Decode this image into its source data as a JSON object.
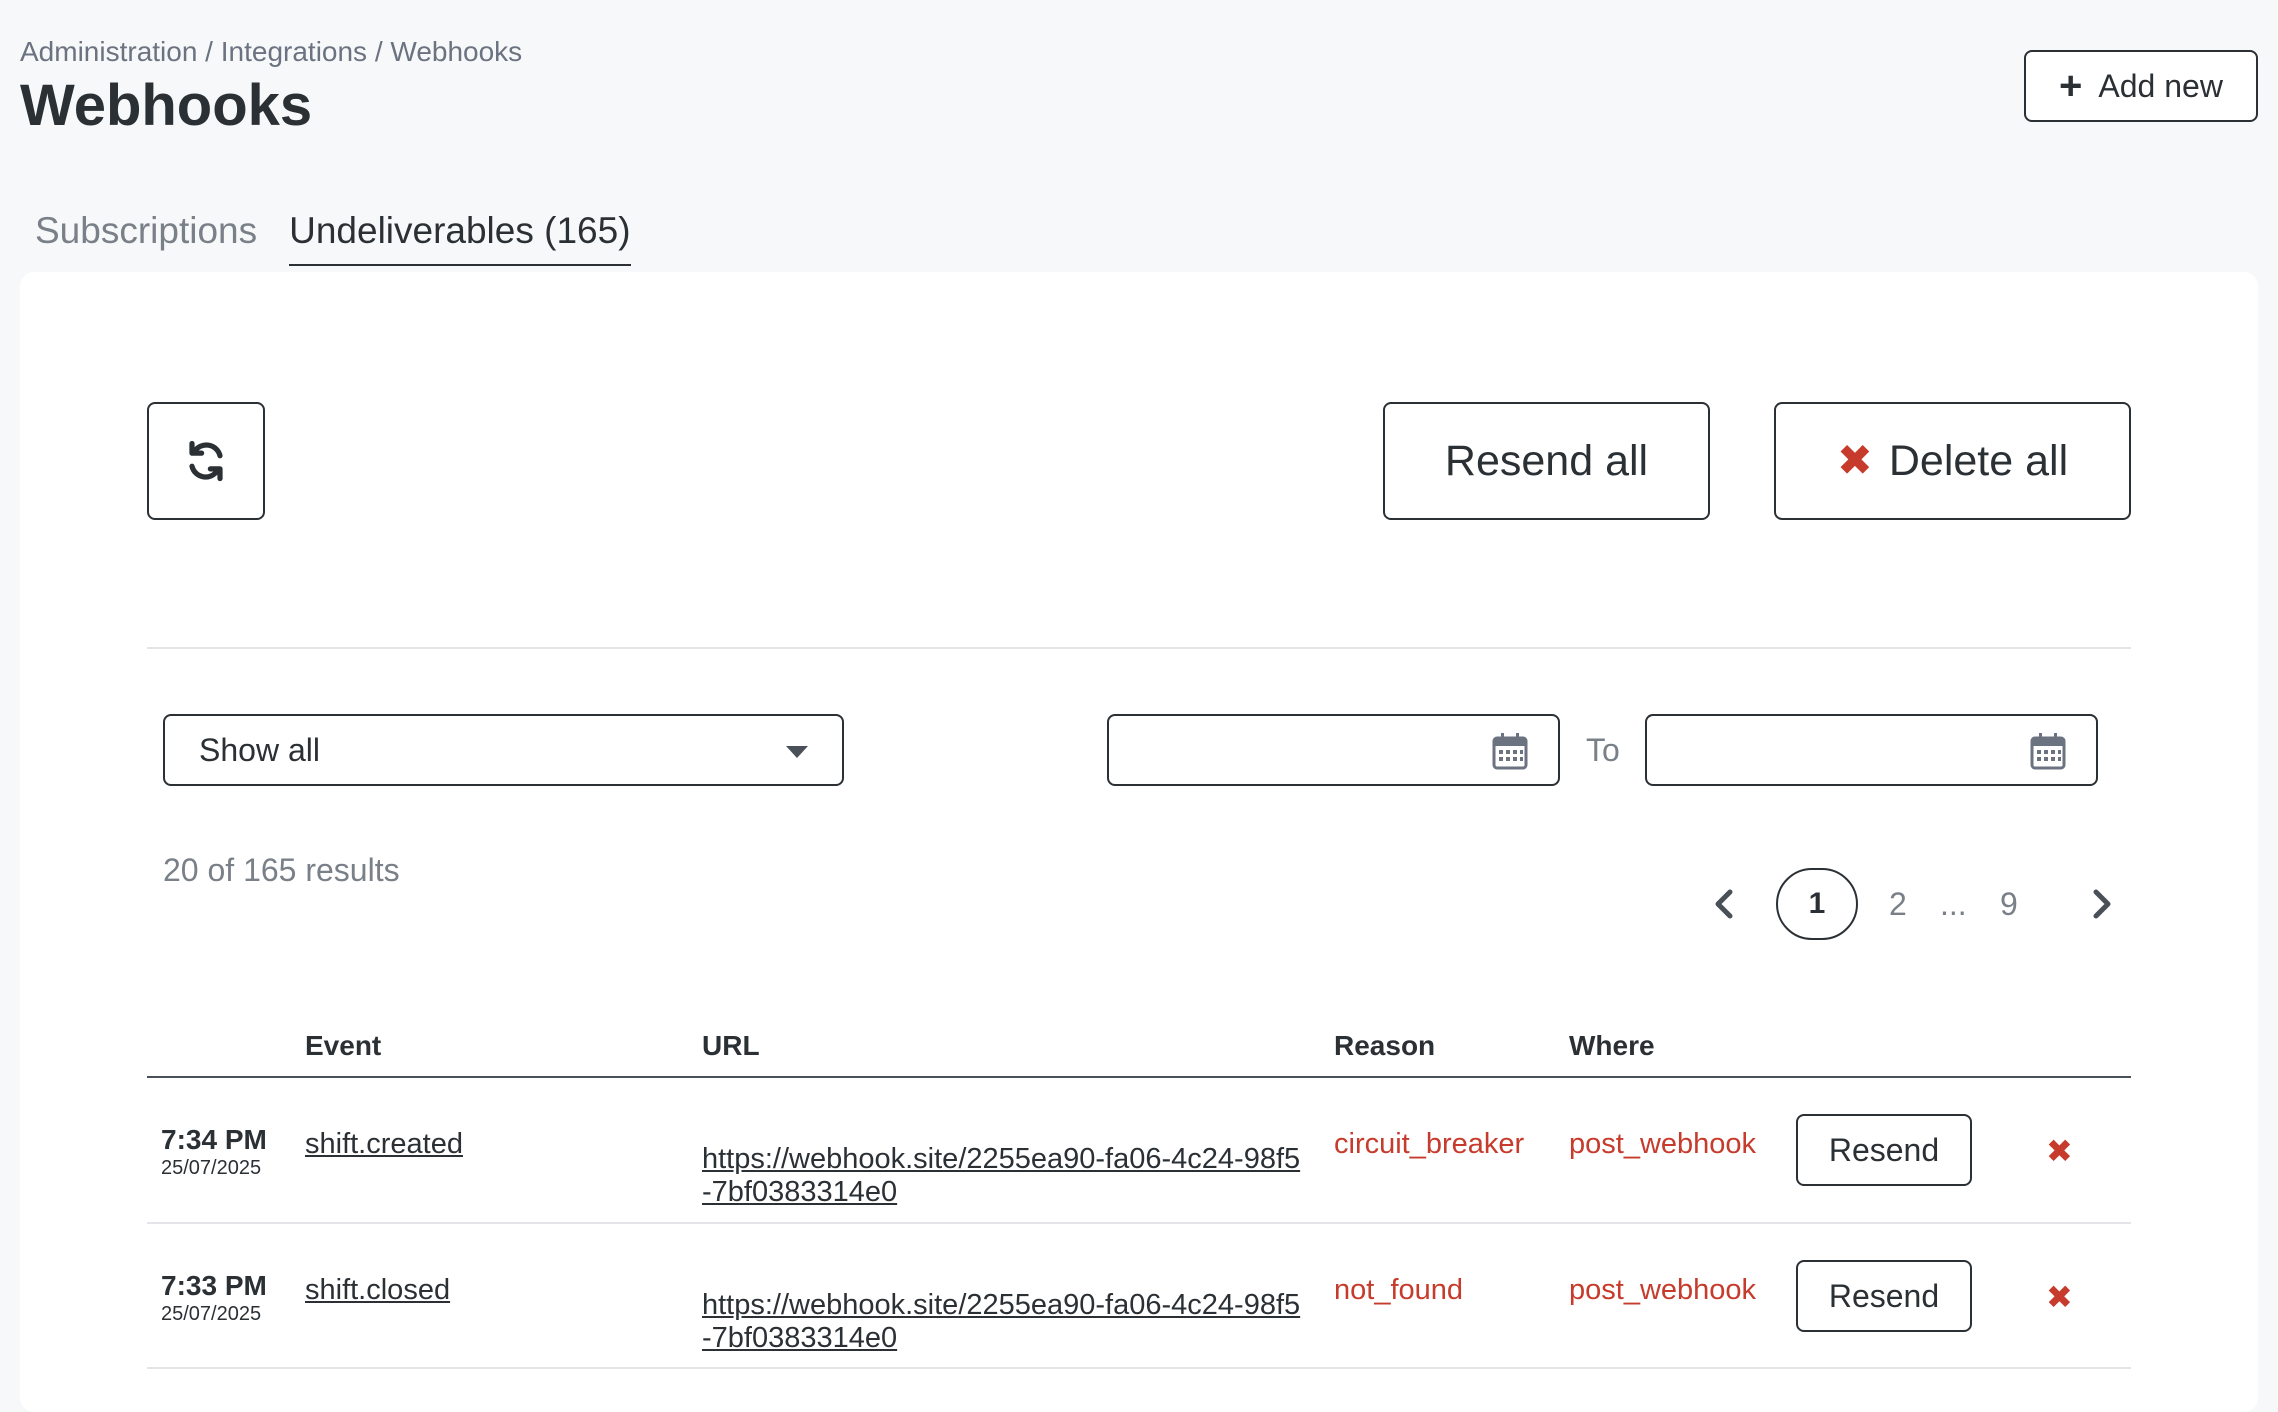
{
  "header": {
    "breadcrumb": "Administration / Integrations / Webhooks",
    "title": "Webhooks",
    "add_new_label": "Add new"
  },
  "tabs": [
    {
      "label": "Subscriptions",
      "active": false
    },
    {
      "label": "Undeliverables (165)",
      "active": true
    }
  ],
  "actions": {
    "resend_all_label": "Resend all",
    "delete_all_label": "Delete all"
  },
  "filters": {
    "select_value": "Show all",
    "to_label": "To",
    "date_from": "",
    "date_to": ""
  },
  "results_text": "20 of 165 results",
  "pagination": {
    "current": "1",
    "page2": "2",
    "ellipsis": "...",
    "last": "9"
  },
  "table": {
    "columns": {
      "event": "Event",
      "url": "URL",
      "reason": "Reason",
      "where": "Where"
    },
    "resend_label": "Resend",
    "rows": [
      {
        "time": "7:34 PM",
        "date": "25/07/2025",
        "event": "shift.created",
        "url": "https://webhook.site/2255ea90-fa06-4c24-98f5-7bf0383314e0",
        "reason": "circuit_breaker",
        "where": "post_webhook"
      },
      {
        "time": "7:33 PM",
        "date": "25/07/2025",
        "event": "shift.closed",
        "url": "https://webhook.site/2255ea90-fa06-4c24-98f5-7bf0383314e0",
        "reason": "not_found",
        "where": "post_webhook"
      }
    ]
  },
  "colors": {
    "accent_red": "#c63b2b",
    "text": "#2b3035",
    "muted": "#7a8088"
  }
}
